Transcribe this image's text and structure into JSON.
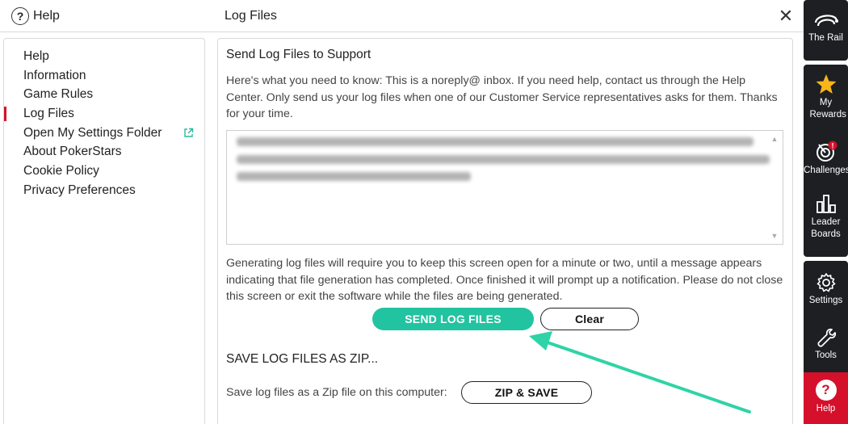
{
  "header": {
    "help_label": "Help",
    "help_icon": "?",
    "title": "Log Files",
    "close_icon": "✕"
  },
  "sidebar": {
    "items": [
      {
        "label": "Help"
      },
      {
        "label": "Information"
      },
      {
        "label": "Game Rules"
      },
      {
        "label": "Log Files",
        "active": true
      },
      {
        "label": "Open My Settings Folder",
        "icon": "external-link-icon"
      },
      {
        "label": "About PokerStars"
      },
      {
        "label": "Cookie Policy"
      },
      {
        "label": "Privacy Preferences"
      }
    ],
    "accent_color": "#d5102a"
  },
  "main": {
    "section_title": "Send Log Files to Support",
    "intro_text": "Here's what you need to know: This is a noreply@ inbox. If you need help, contact us through the Help Center. Only send us your log files when one of our Customer Service representatives asks for them. Thanks for your time.",
    "generating_text": "Generating log files will require you to keep this screen open for a minute or two, until a message appears indicating that file generation has completed. Once finished it will prompt up a notification. Please do not close this screen or exit the software while the files are being generated.",
    "send_button": "SEND LOG FILES",
    "clear_button": "Clear",
    "zip_section_title": "SAVE LOG FILES AS ZIP...",
    "zip_text": "Save log files as a Zip file on this computer:",
    "zip_button": "ZIP & SAVE",
    "send_color": "#22c3a0"
  },
  "rightbar": {
    "items": [
      {
        "label": "The Rail",
        "icon": "rail-icon"
      },
      {
        "label": "My Rewards",
        "icon": "star-icon"
      },
      {
        "label": "Challenges",
        "icon": "target-icon"
      },
      {
        "label": "Leader Boards",
        "icon": "bar-chart-icon"
      },
      {
        "label": "Settings",
        "icon": "gear-icon"
      },
      {
        "label": "Tools",
        "icon": "wrench-icon"
      },
      {
        "label": "Help",
        "icon": "help-icon",
        "active": true
      }
    ],
    "challenges_badge": "!"
  }
}
